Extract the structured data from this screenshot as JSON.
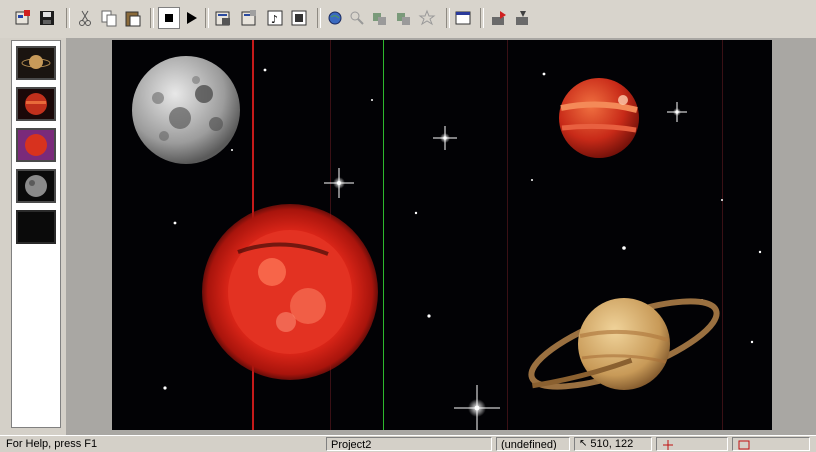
{
  "toolbar": {
    "buttons": [
      "properties-icon",
      "save-icon",
      "cut-icon",
      "copy-icon",
      "paste-icon",
      "stop-icon",
      "play-icon",
      "page-properties-icon",
      "page-settings-icon",
      "music-icon",
      "sound-icon",
      "globe-icon",
      "zoom-icon",
      "object-icon",
      "object2-icon",
      "effects-icon",
      "window-icon",
      "export-icon",
      "publish-icon"
    ]
  },
  "colors": {
    "guide_red": "#c41a1a",
    "guide_green": "#2db82d",
    "space": "#020205"
  },
  "thumbnails": [
    {
      "name": "thumb-saturn",
      "color": "#c79a5a"
    },
    {
      "name": "thumb-jupiter",
      "color": "#c0301c"
    },
    {
      "name": "thumb-sun",
      "color": "#d8321e"
    },
    {
      "name": "thumb-moon",
      "color": "#8a8a8a"
    },
    {
      "name": "thumb-space",
      "color": "#0a0a0a"
    }
  ],
  "status": {
    "help": "For Help, press F1",
    "project": "Project2",
    "state": "(undefined)",
    "coords": "510, 122"
  }
}
